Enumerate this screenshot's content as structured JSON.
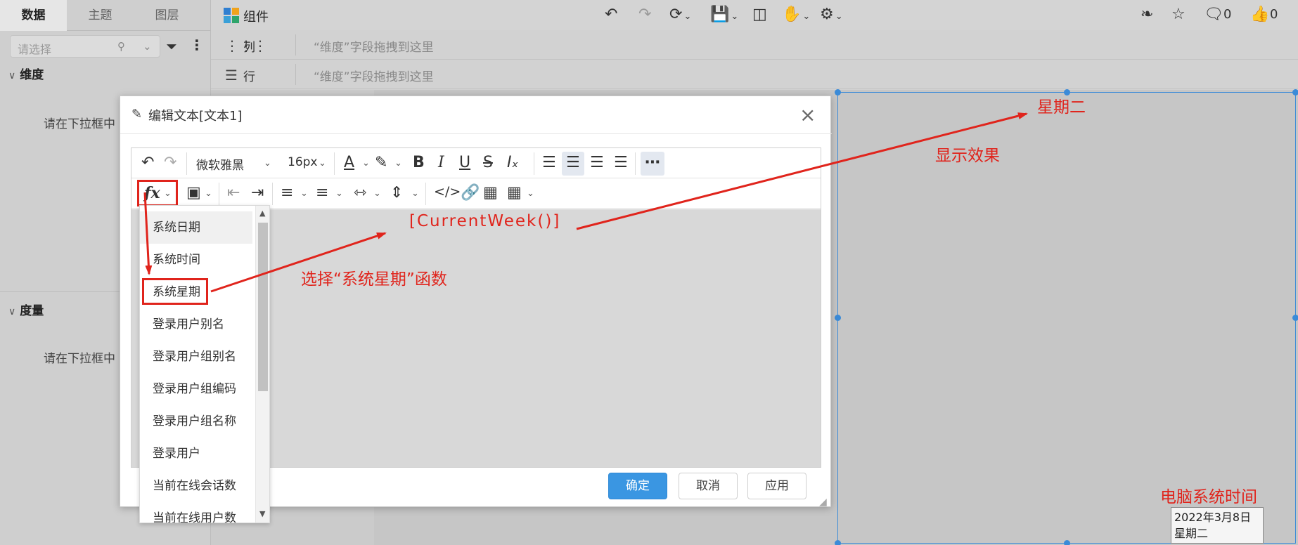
{
  "left_panel": {
    "tabs": [
      "数据",
      "主题",
      "图层"
    ],
    "search_placeholder": "请选择",
    "dimension_title": "维度",
    "dimension_hint": "请在下拉框中",
    "measure_title": "度量",
    "measure_hint": "请在下拉框中"
  },
  "toolbar": {
    "component_label": "组件",
    "comment_count": "0",
    "like_count": "0"
  },
  "zones": {
    "columns_label": "列",
    "columns_hint": "“维度”字段拖拽到这里",
    "rows_label": "行",
    "rows_hint": "“维度”字段拖拽到这里"
  },
  "modal": {
    "title": "编辑文本[文本1]",
    "font_family": "微软雅黑",
    "font_size": "16px",
    "formula_text": "[CurrentWeek()]",
    "buttons": {
      "confirm": "确定",
      "cancel": "取消",
      "apply": "应用"
    }
  },
  "function_list": {
    "items": [
      "系统日期",
      "系统时间",
      "系统星期",
      "登录用户别名",
      "登录用户组别名",
      "登录用户组编码",
      "登录用户组名称",
      "登录用户",
      "当前在线会话数",
      "当前在线用户数"
    ],
    "selected_index": 2
  },
  "canvas": {
    "display_text": "星期二",
    "tooltip_date": "2022年3月8日",
    "tooltip_weekday": "星期二"
  },
  "annotations": {
    "select_function": "选择“系统星期”函数",
    "display_effect": "显示效果",
    "system_time": "电脑系统时间"
  },
  "colors": {
    "annotation": "#e0241c",
    "selection": "#3b8bd8",
    "primary_button": "#3a96e2"
  }
}
